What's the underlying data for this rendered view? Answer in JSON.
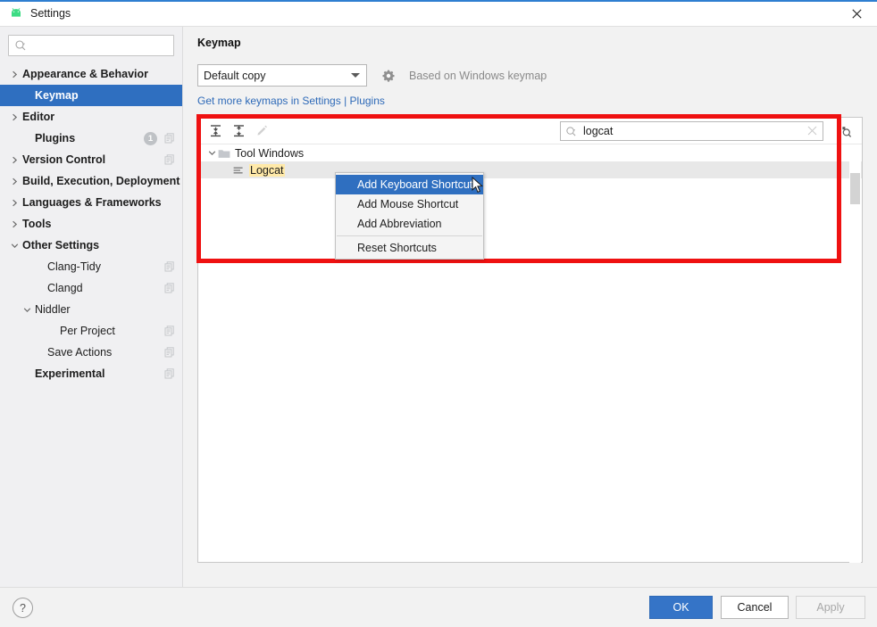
{
  "window": {
    "title": "Settings",
    "app_icon": "android-icon",
    "close_icon": "close-icon"
  },
  "sidebar": {
    "search": {
      "placeholder": "",
      "value": "",
      "icon": "search-icon"
    },
    "items": [
      {
        "label": "Appearance & Behavior",
        "arrow": "chevron-right",
        "indent": 0,
        "bold": true,
        "selected": false,
        "badge": null,
        "config_icon": false
      },
      {
        "label": "Keymap",
        "arrow": "none",
        "indent": 1,
        "bold": true,
        "selected": true,
        "badge": null,
        "config_icon": false
      },
      {
        "label": "Editor",
        "arrow": "chevron-right",
        "indent": 0,
        "bold": true,
        "selected": false,
        "badge": null,
        "config_icon": false
      },
      {
        "label": "Plugins",
        "arrow": "none",
        "indent": 1,
        "bold": true,
        "selected": false,
        "badge": "1",
        "config_icon": true
      },
      {
        "label": "Version Control",
        "arrow": "chevron-right",
        "indent": 0,
        "bold": true,
        "selected": false,
        "badge": null,
        "config_icon": true
      },
      {
        "label": "Build, Execution, Deployment",
        "arrow": "chevron-right",
        "indent": 0,
        "bold": true,
        "selected": false,
        "badge": null,
        "config_icon": false
      },
      {
        "label": "Languages & Frameworks",
        "arrow": "chevron-right",
        "indent": 0,
        "bold": true,
        "selected": false,
        "badge": null,
        "config_icon": false
      },
      {
        "label": "Tools",
        "arrow": "chevron-right",
        "indent": 0,
        "bold": true,
        "selected": false,
        "badge": null,
        "config_icon": false
      },
      {
        "label": "Other Settings",
        "arrow": "chevron-down",
        "indent": 0,
        "bold": true,
        "selected": false,
        "badge": null,
        "config_icon": false
      },
      {
        "label": "Clang-Tidy",
        "arrow": "none",
        "indent": 2,
        "bold": false,
        "selected": false,
        "badge": null,
        "config_icon": true
      },
      {
        "label": "Clangd",
        "arrow": "none",
        "indent": 2,
        "bold": false,
        "selected": false,
        "badge": null,
        "config_icon": true
      },
      {
        "label": "Niddler",
        "arrow": "chevron-down",
        "indent": 1,
        "bold": false,
        "selected": false,
        "badge": null,
        "config_icon": false
      },
      {
        "label": "Per Project",
        "arrow": "none",
        "indent": 3,
        "bold": false,
        "selected": false,
        "badge": null,
        "config_icon": true
      },
      {
        "label": "Save Actions",
        "arrow": "none",
        "indent": 2,
        "bold": false,
        "selected": false,
        "badge": null,
        "config_icon": true
      },
      {
        "label": "Experimental",
        "arrow": "none",
        "indent": 1,
        "bold": true,
        "selected": false,
        "badge": null,
        "config_icon": true
      }
    ]
  },
  "main": {
    "page_title": "Keymap",
    "keymap_select": {
      "value": "Default copy",
      "icon": "chevron-down-icon"
    },
    "gear_icon": "gear-icon",
    "based_on": "Based on Windows keymap",
    "get_more_link": "Get more keymaps in Settings | Plugins",
    "toolbar": {
      "expand_all": "expand-all-icon",
      "collapse_all": "collapse-all-icon",
      "edit": "edit-pencil-icon"
    },
    "search": {
      "value": "logcat",
      "placeholder": "",
      "icon": "search-icon",
      "clear_icon": "clear-x-icon"
    },
    "find_by_shortcut_icon": "find-by-shortcut-icon",
    "tree": [
      {
        "label": "Tool Windows",
        "type": "group",
        "twisty": "chevron-down",
        "icon": "folder-icon",
        "highlight": false,
        "selected": false
      },
      {
        "label": "Logcat",
        "type": "action",
        "twisty": "none",
        "icon": "action-icon",
        "highlight": true,
        "selected": true
      }
    ]
  },
  "context_menu": {
    "items": [
      {
        "label": "Add Keyboard Shortcut",
        "highlighted": true,
        "separator_after": false
      },
      {
        "label": "Add Mouse Shortcut",
        "highlighted": false,
        "separator_after": false
      },
      {
        "label": "Add Abbreviation",
        "highlighted": false,
        "separator_after": true
      },
      {
        "label": "Reset Shortcuts",
        "highlighted": false,
        "separator_after": false
      }
    ]
  },
  "annotation": {
    "color": "#ef1111"
  },
  "footer": {
    "help_label": "?",
    "ok_label": "OK",
    "cancel_label": "Cancel",
    "apply_label": "Apply"
  },
  "colors": {
    "accent": "#2f6fc0",
    "primary_button": "#3574c7",
    "link": "#2e6ab8",
    "highlight": "#ffe9a8",
    "annotation_red": "#ef1111"
  }
}
